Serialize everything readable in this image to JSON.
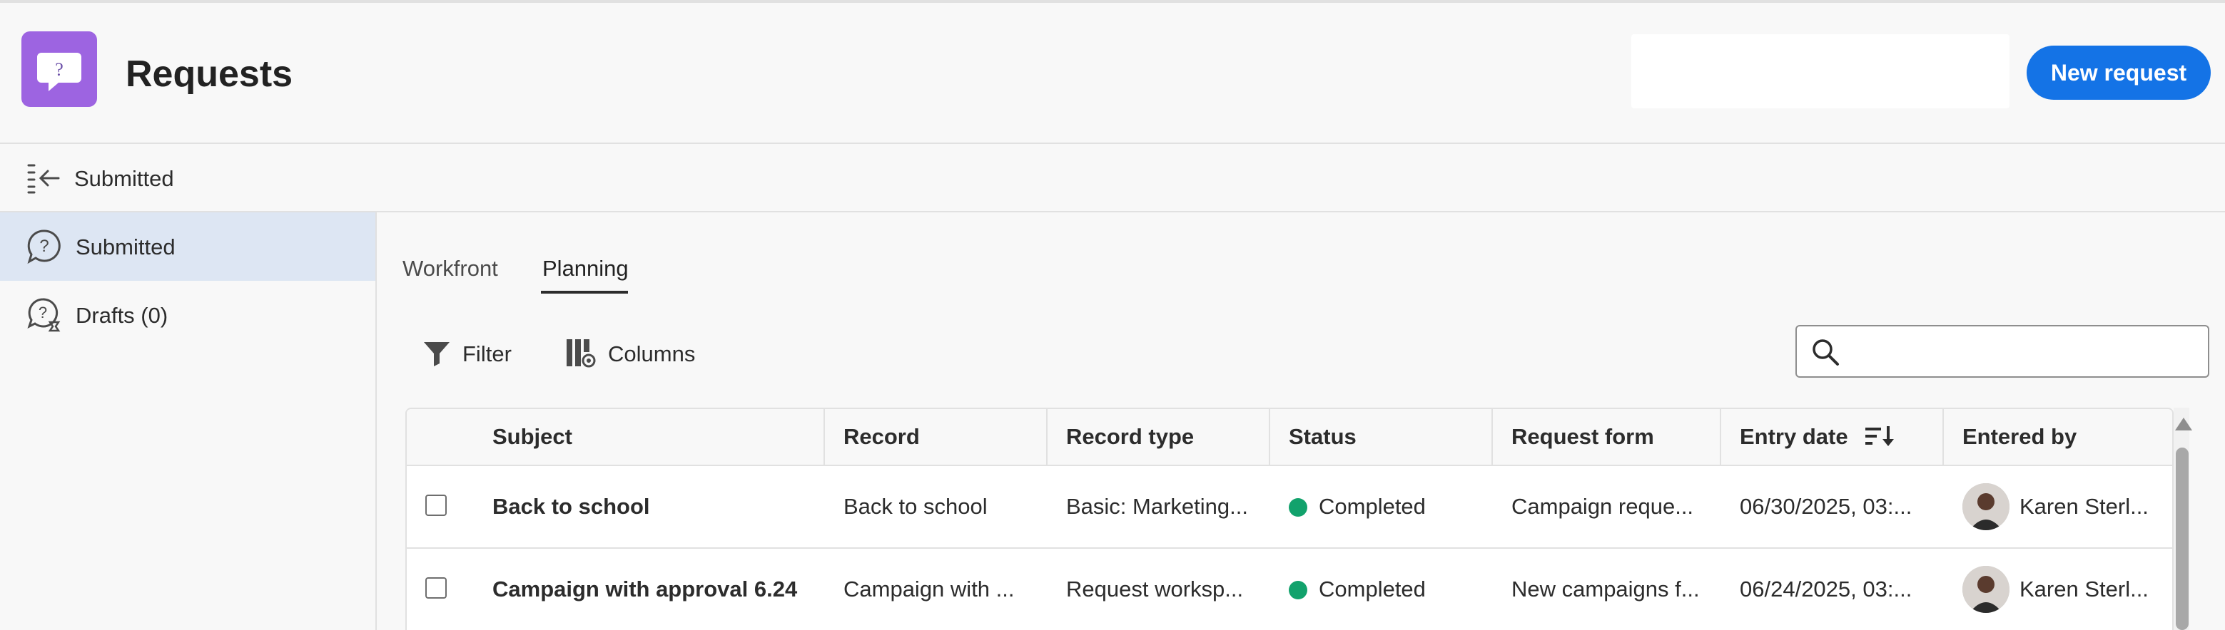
{
  "header": {
    "title": "Requests",
    "new_request_label": "New request",
    "logo_icon": "question-bubble-icon",
    "brand_color": "#9d64e1",
    "accent_color": "#1473e6"
  },
  "subheader": {
    "title": "Submitted",
    "collapse_icon": "collapse-left-icon"
  },
  "sidebar": {
    "items": [
      {
        "label": "Submitted",
        "icon": "question-bubble-icon",
        "active": true
      },
      {
        "label": "Drafts (0)",
        "icon": "question-bubble-draft-icon",
        "active": false
      }
    ]
  },
  "tabs": [
    {
      "label": "Workfront",
      "active": false
    },
    {
      "label": "Planning",
      "active": true
    }
  ],
  "toolbar": {
    "filter_label": "Filter",
    "columns_label": "Columns",
    "search_placeholder": "",
    "search_value": ""
  },
  "table": {
    "columns": [
      "Subject",
      "Record",
      "Record type",
      "Status",
      "Request form",
      "Entry date",
      "Entered by"
    ],
    "sort_column": "Entry date",
    "rows": [
      {
        "subject": "Back to school",
        "record": "Back to school",
        "record_type": "Basic: Marketing...",
        "status": "Completed",
        "request_form": "Campaign reque...",
        "entry_date": "06/30/2025, 03:...",
        "entered_by": "Karen Sterl..."
      },
      {
        "subject": "Campaign with approval 6.24",
        "record": "Campaign with ...",
        "record_type": "Request worksp...",
        "status": "Completed",
        "request_form": "New campaigns f...",
        "entry_date": "06/24/2025, 03:...",
        "entered_by": "Karen Sterl..."
      }
    ],
    "status_color": "#12a26c"
  }
}
